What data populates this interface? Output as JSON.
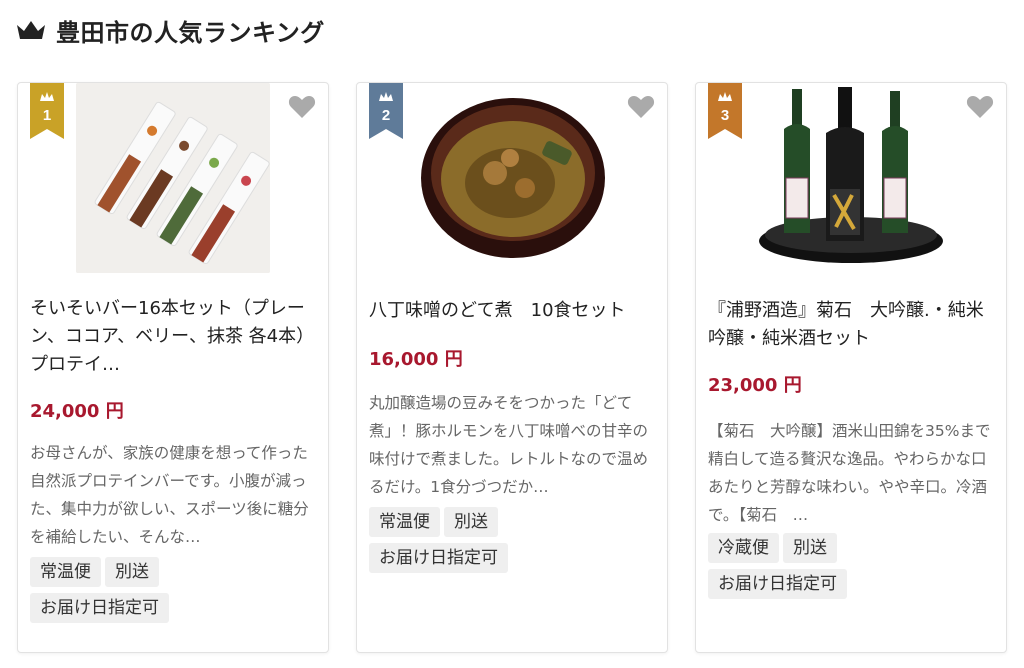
{
  "header": {
    "title": "豊田市の人気ランキング",
    "icon": "crown-icon"
  },
  "colors": {
    "gold": "#c9a227",
    "silver": "#5f7b99",
    "bronze": "#c3772a",
    "price": "#a8182e"
  },
  "items": [
    {
      "rank": "1",
      "name": "そいそいバー16本セット（プレーン、ココア、ベリー、抹茶 各4本）プロテイ…",
      "price": "24,000 円",
      "description": "お母さんが、家族の健康を想って作った自然派プロテインバーです。小腹が減った、集中力が欲しい、スポーツ後に糖分を補給したい、そんな…",
      "tags": [
        "常温便",
        "別送"
      ],
      "tag_delivery": "お届け日指定可"
    },
    {
      "rank": "2",
      "name": "八丁味噌のどて煮　10食セット",
      "price": "16,000 円",
      "description": "丸加醸造場の豆みそをつかった「どて煮」！豚ホルモンを八丁味噌べの甘辛の味付けで煮ました。レトルトなので温めるだけ。1食分づつだか…",
      "tags": [
        "常温便",
        "別送"
      ],
      "tag_delivery": "お届け日指定可"
    },
    {
      "rank": "3",
      "name": "『浦野酒造』菊石　大吟醸.・純米吟醸・純米酒セット",
      "price": "23,000 円",
      "description": "【菊石　大吟醸】酒米山田錦を35%まで精白して造る贅沢な逸品。やわらかな口あたりと芳醇な味わい。やや辛口。冷酒で。【菊石　…",
      "tags": [
        "冷蔵便",
        "別送"
      ],
      "tag_delivery": "お届け日指定可"
    }
  ]
}
